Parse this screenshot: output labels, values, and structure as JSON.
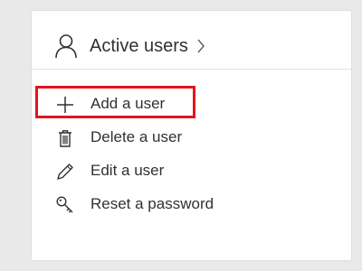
{
  "header": {
    "title": "Active users",
    "icon": "person-icon",
    "chevron_icon": "chevron-right-icon"
  },
  "actions": [
    {
      "label": "Add a user",
      "icon": "plus-icon",
      "highlighted": true
    },
    {
      "label": "Delete a user",
      "icon": "trash-icon"
    },
    {
      "label": "Edit a user",
      "icon": "pencil-icon"
    },
    {
      "label": "Reset a password",
      "icon": "key-icon"
    }
  ],
  "colors": {
    "highlight_border": "#e0161e",
    "text": "#323130",
    "background": "#e9e9e9",
    "card": "#ffffff"
  }
}
